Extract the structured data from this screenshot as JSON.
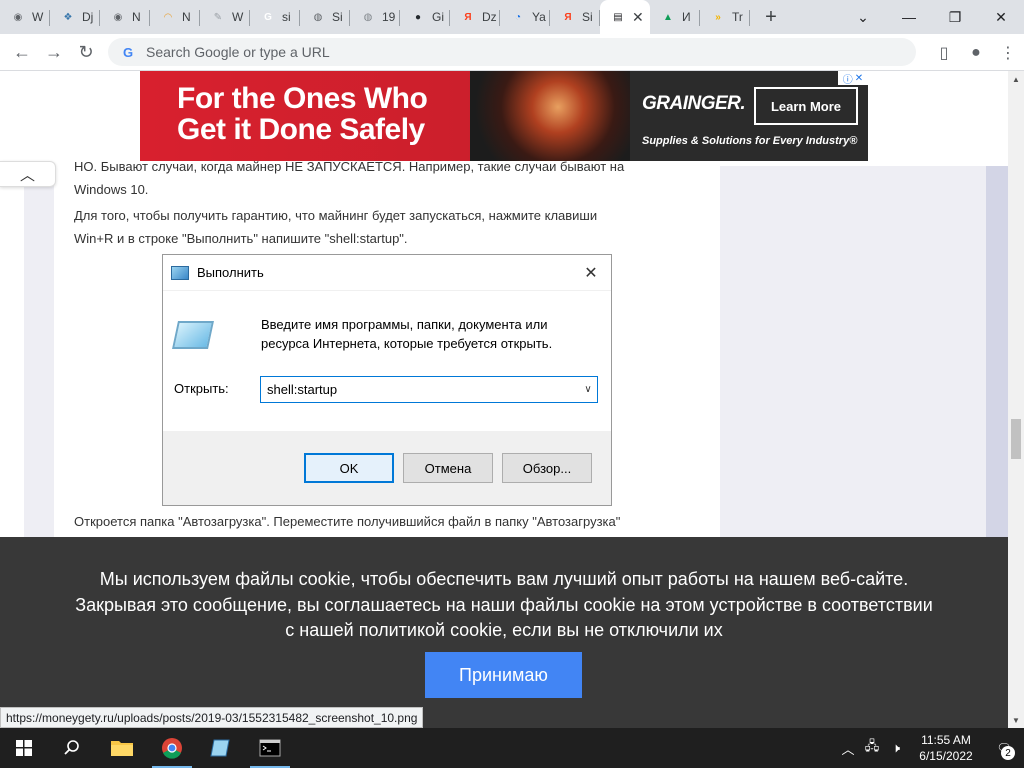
{
  "browser": {
    "tabs": [
      {
        "label": "W",
        "icon": "chrome-icon",
        "color": "#5f6368",
        "glyph": "◉"
      },
      {
        "label": "Dj",
        "icon": "python-icon",
        "color": "#3776ab",
        "glyph": "❖"
      },
      {
        "label": "N",
        "icon": "chrome-icon",
        "color": "#5f6368",
        "glyph": "◉"
      },
      {
        "label": "N",
        "icon": "rainbow-icon",
        "color": "#e8a33b",
        "glyph": "◠"
      },
      {
        "label": "W",
        "icon": "leaf-icon",
        "color": "#9aa0a6",
        "glyph": "✎"
      },
      {
        "label": "si",
        "icon": "google-icon",
        "color": "#ffffff",
        "glyph": "G"
      },
      {
        "label": "Si",
        "icon": "globe-icon",
        "color": "#5f6368",
        "glyph": "◍"
      },
      {
        "label": "19",
        "icon": "globe-icon",
        "color": "#80868b",
        "glyph": "◍"
      },
      {
        "label": "Gi",
        "icon": "github-icon",
        "color": "#24292e",
        "glyph": "●"
      },
      {
        "label": "Dz",
        "icon": "yandex-icon",
        "color": "#fc3f1d",
        "glyph": "Я"
      },
      {
        "label": "Ya",
        "icon": "blue-swirl-icon",
        "color": "#1a73e8",
        "glyph": "◔"
      },
      {
        "label": "Si",
        "icon": "yandex-icon",
        "color": "#fc3f1d",
        "glyph": "Я"
      },
      {
        "label": "",
        "icon": "database-icon",
        "color": "#202124",
        "glyph": "▤",
        "active": true
      },
      {
        "label": "И",
        "icon": "google-drive-icon",
        "color": "#0f9d58",
        "glyph": "▲"
      },
      {
        "label": "Tr",
        "icon": "chevrons-icon",
        "color": "#f4b400",
        "glyph": "»"
      }
    ],
    "new_tab_glyph": "+",
    "omnibox": {
      "placeholder": "Search Google or type a URL",
      "value": ""
    },
    "status_url": "https://moneygety.ru/uploads/posts/2019-03/1552315482_screenshot_10.png"
  },
  "ad": {
    "headline_line1": "For the Ones Who",
    "headline_line2": "Get it Done Safely",
    "brand": "GRAINGER.",
    "cta": "Learn More",
    "tagline": "Supplies & Solutions for Every Industry®"
  },
  "article": {
    "para1_line1": "НО. Бывают случаи, когда майнер НЕ ЗАПУСКАЕТСЯ. Например, такие случаи бывают на",
    "para1_line2": "Windows 10.",
    "para2_line1": "Для того, чтобы получить гарантию, что майнинг будет запускаться, нажмите клавиши",
    "para2_line2": "Win+R и в строке \"Выполнить\" напишите \"shell:startup\".",
    "para3": "Откроется папка \"Автозагрузка\". Переместите получившийся файл в папку \"Автозагрузка\""
  },
  "run_dialog": {
    "title": "Выполнить",
    "message": "Введите имя программы, папки, документа или ресурса Интернета, которые требуется открыть.",
    "open_label": "Открыть:",
    "input_value": "shell:startup",
    "ok": "OK",
    "cancel": "Отмена",
    "browse": "Обзор..."
  },
  "cookie_banner": {
    "text_line1": "Мы используем файлы cookie, чтобы обеспечить вам лучший опыт работы на нашем веб-сайте.",
    "text_line2": "Закрывая это сообщение, вы соглашаетесь на наши файлы cookie на этом устройстве в соответствии",
    "text_line3": "с нашей политикой cookie, если вы не отключили их",
    "accept": "Принимаю"
  },
  "taskbar": {
    "time": "11:55 AM",
    "date": "6/15/2022",
    "notification_count": "2"
  }
}
